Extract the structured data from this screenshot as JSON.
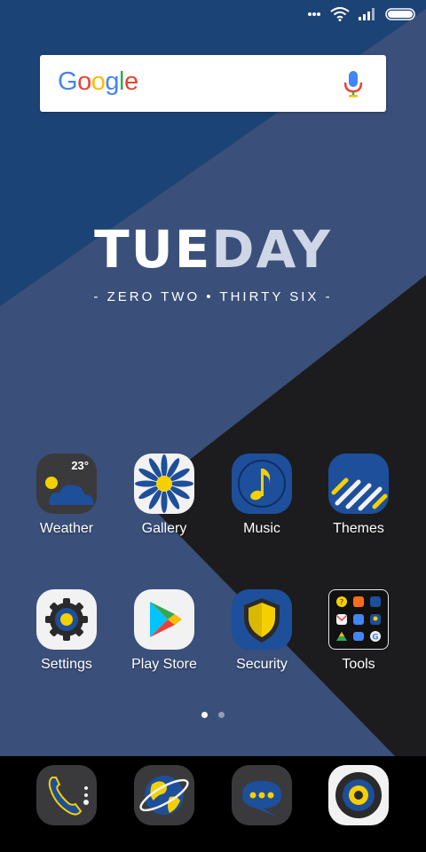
{
  "wallpaper": {
    "top_left": "#1c4375",
    "mid": "#3a4f7a",
    "dark": "#1c1c1e",
    "light_band": "#3f5886"
  },
  "search": {
    "logo": "Google",
    "placeholder_icon": "mic-icon"
  },
  "clock": {
    "day_part1": "TUE",
    "day_part2": "DAY",
    "date": "- ZERO TWO • THIRTY SIX -"
  },
  "apps": [
    {
      "label": "Weather",
      "icon": "weather-icon",
      "temp": "23°"
    },
    {
      "label": "Gallery",
      "icon": "gallery-icon"
    },
    {
      "label": "Music",
      "icon": "music-note-icon"
    },
    {
      "label": "Themes",
      "icon": "themes-icon"
    },
    {
      "label": "Settings",
      "icon": "gear-icon"
    },
    {
      "label": "Play Store",
      "icon": "play-store-icon"
    },
    {
      "label": "Security",
      "icon": "shield-icon"
    },
    {
      "label": "Tools",
      "icon": "folder-icon"
    }
  ],
  "dock": [
    {
      "name": "phone",
      "icon": "phone-icon"
    },
    {
      "name": "browser",
      "icon": "globe-icon"
    },
    {
      "name": "messages",
      "icon": "chat-icon"
    },
    {
      "name": "camera",
      "icon": "camera-icon"
    }
  ],
  "page_indicator": {
    "count": 2,
    "active": 0
  },
  "colors": {
    "accent_yellow": "#f5d000",
    "icon_dark": "#3a3a3c",
    "icon_blue": "#1e4f9a",
    "icon_light": "#f2f2f2"
  }
}
